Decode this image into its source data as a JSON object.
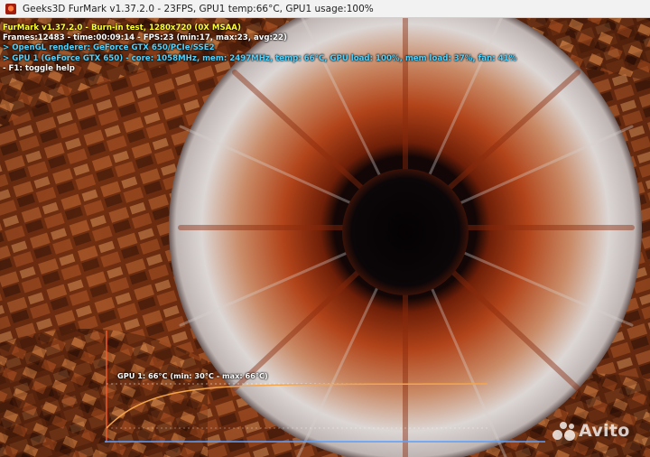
{
  "window": {
    "title": "Geeks3D FurMark v1.37.2.0 - 23FPS, GPU1 temp:66°C, GPU1 usage:100%"
  },
  "hud": {
    "line1": "FurMark v1.37.2.0 - Burn-in test, 1280x720 (0X MSAA)",
    "line2": "Frames:12483 - time:00:09:14 - FPS:23 (min:17, max:23, avg:22)",
    "line3": "> OpenGL renderer: GeForce GTX 650/PCIe/SSE2",
    "line4": "> GPU 1 (GeForce GTX 650) - core: 1058MHz, mem: 2497MHz, temp: 66°C, GPU load: 100%, mem load: 37%, fan: 41%",
    "line5": "- F1: toggle help"
  },
  "temp_graph": {
    "label": "GPU 1: 66°C (min: 30°C - max: 66°C)",
    "min_c": 30,
    "max_c": 66,
    "current_c": 66,
    "line_color": "#f5a64a",
    "axis_color": "#ff5a2a",
    "baseline_color": "#5aa0ff"
  },
  "watermark": {
    "text": "Avito"
  },
  "colors": {
    "hud_yellow": "#ffff2e",
    "hud_cyan": "#4fd3ff",
    "iris_orange": "#b8481c",
    "pupil": "#0b0608"
  }
}
